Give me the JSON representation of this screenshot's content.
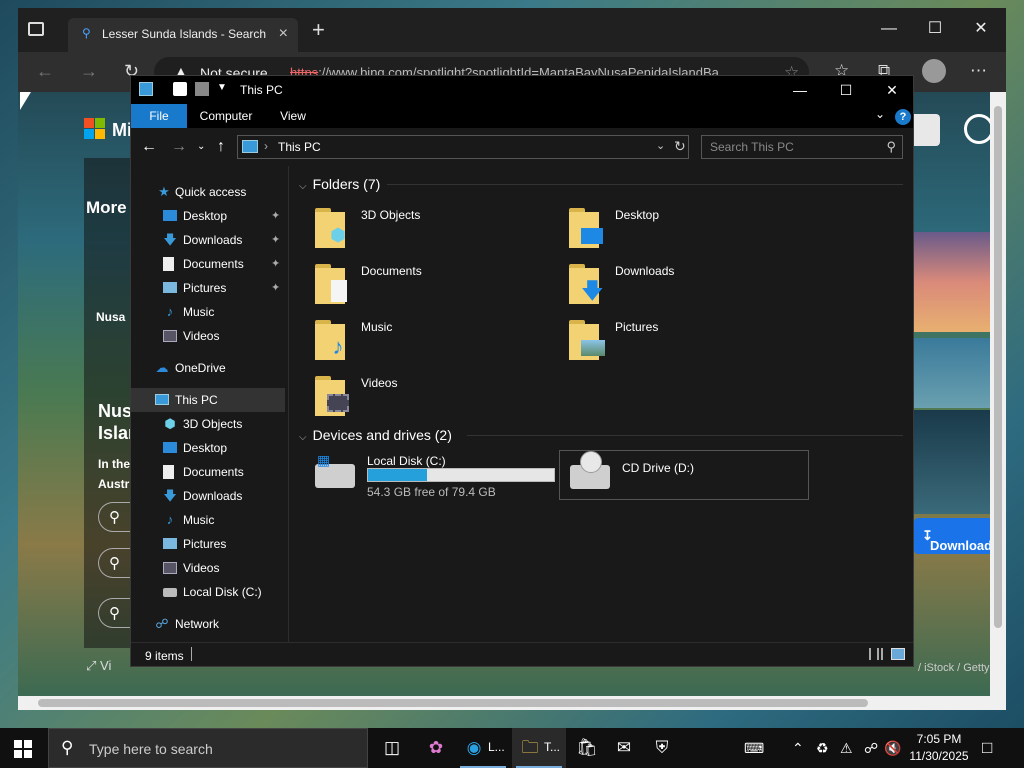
{
  "browser": {
    "tab_title": "Lesser Sunda Islands - Search",
    "not_secure": "Not secure",
    "url_scheme": "https",
    "url_rest": "://www.bing.com/spotlight?spotlightId=MantaBayNusaPenidaIslandBa...",
    "page": {
      "brand": "Mi",
      "more": "More",
      "nusa_small": "Nusa",
      "title_lines": "Nus\nIslan",
      "subtitle_lines": "In the\nAustr",
      "view": "Vi",
      "download": "Download",
      "credit": "/ iStock / Getty"
    }
  },
  "explorer": {
    "title": "This PC",
    "ribbon": {
      "tabs": [
        "File",
        "Computer",
        "View"
      ],
      "help": "?"
    },
    "address": {
      "path": "This PC",
      "search_placeholder": "Search This PC"
    },
    "nav": [
      {
        "label": "Quick access",
        "icon": "star-icon"
      },
      {
        "label": "Desktop",
        "icon": "desktop-icon"
      },
      {
        "label": "Downloads",
        "icon": "download-icon"
      },
      {
        "label": "Documents",
        "icon": "document-icon"
      },
      {
        "label": "Pictures",
        "icon": "pictures-icon"
      },
      {
        "label": "Music",
        "icon": "music-icon"
      },
      {
        "label": "Videos",
        "icon": "videos-icon"
      },
      {
        "label": "OneDrive",
        "icon": "cloud-icon"
      },
      {
        "label": "This PC",
        "icon": "pc-icon"
      },
      {
        "label": "3D Objects",
        "icon": "cube-icon"
      },
      {
        "label": "Desktop",
        "icon": "desktop-icon"
      },
      {
        "label": "Documents",
        "icon": "document-icon"
      },
      {
        "label": "Downloads",
        "icon": "download-icon"
      },
      {
        "label": "Music",
        "icon": "music-icon"
      },
      {
        "label": "Pictures",
        "icon": "pictures-icon"
      },
      {
        "label": "Videos",
        "icon": "videos-icon"
      },
      {
        "label": "Local Disk (C:)",
        "icon": "drive-icon"
      },
      {
        "label": "Network",
        "icon": "network-icon"
      }
    ],
    "folders_header": "Folders (7)",
    "folders": [
      {
        "name": "3D Objects"
      },
      {
        "name": "Desktop"
      },
      {
        "name": "Documents"
      },
      {
        "name": "Downloads"
      },
      {
        "name": "Music"
      },
      {
        "name": "Pictures"
      },
      {
        "name": "Videos"
      }
    ],
    "drives_header": "Devices and drives (2)",
    "drives": [
      {
        "name": "Local Disk (C:)",
        "free": "54.3 GB free of 79.4 GB",
        "used_fraction": 0.316
      },
      {
        "name": "CD Drive (D:)"
      }
    ],
    "status": "9 items"
  },
  "taskbar": {
    "search_placeholder": "Type here to search",
    "edge_label": "L...",
    "explorer_label": "T...",
    "time": "7:05 PM",
    "date": "11/30/2025"
  },
  "colors": {
    "accent": "#1979ca",
    "drive_fill": "#26a0da",
    "folder": "#f3d273"
  }
}
